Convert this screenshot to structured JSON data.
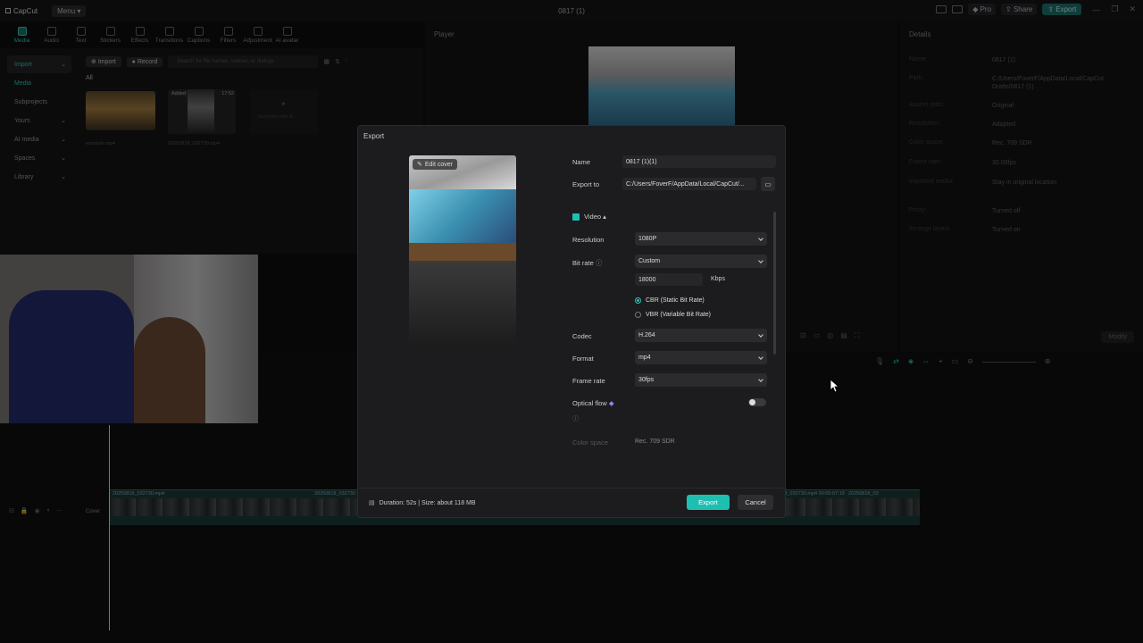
{
  "app": {
    "brand": "CapCut",
    "menu": "Menu",
    "project_title": "0817 (1)"
  },
  "titlebar": {
    "pro": "Pro",
    "share": "Share",
    "export": "Export"
  },
  "toolbar": [
    "Media",
    "Audio",
    "Text",
    "Stickers",
    "Effects",
    "Transitions",
    "Captions",
    "Filters",
    "Adjustment",
    "AI avatar"
  ],
  "sidebar": [
    "Import",
    "Media",
    "Subprojects",
    "Yours",
    "AI media",
    "Spaces",
    "Library"
  ],
  "media": {
    "import": "Import",
    "record": "Record",
    "search_placeholder": "Search for file names, scenes, or dialogs",
    "all_tab": "All",
    "added": "Added",
    "duration": "17:52",
    "clip1": "example.mp4",
    "clip2": "20250818_032730.mp4",
    "generate": "Generate with AI"
  },
  "player": {
    "title": "Player"
  },
  "details": {
    "title": "Details",
    "rows": [
      {
        "k": "Name:",
        "v": "0817 (1)"
      },
      {
        "k": "Path:",
        "v": "C:/Users/FoverF/AppData/Local/CapCut Drafts/0817 (1)"
      },
      {
        "k": "Aspect ratio:",
        "v": "Original"
      },
      {
        "k": "Resolution:",
        "v": "Adapted"
      },
      {
        "k": "Color space:",
        "v": "Rec. 709 SDR"
      },
      {
        "k": "Frame rate:",
        "v": "30.00fps"
      },
      {
        "k": "Imported media:",
        "v": "Stay in original location"
      },
      {
        "k": "Proxy:",
        "v": "Turned off"
      },
      {
        "k": "Arrange layers",
        "v": "Turned on"
      }
    ],
    "modify": "Modify"
  },
  "timeline": {
    "cover": "Cover",
    "clip_labels": [
      "20250818_032730.mp4  00:00:07:19",
      "20250818_03",
      "20250818_032730.mp4",
      "20250818_032730"
    ]
  },
  "export_dialog": {
    "title": "Export",
    "edit_cover": "Edit cover",
    "name_label": "Name",
    "name_value": "0817 (1)(1)",
    "export_to_label": "Export to",
    "export_to_value": "C:/Users/FoverF/AppData/Local/CapCut/...",
    "video_label": "Video",
    "resolution_label": "Resolution",
    "resolution_value": "1080P",
    "bitrate_label": "Bit rate",
    "bitrate_value": "Custom",
    "kbps_value": "18000",
    "kbps_unit": "Kbps",
    "cbr": "CBR (Static Bit Rate)",
    "vbr": "VBR (Variable Bit Rate)",
    "codec_label": "Codec",
    "codec_value": "H.264",
    "format_label": "Format",
    "format_value": "mp4",
    "framerate_label": "Frame rate",
    "framerate_value": "30fps",
    "optical_flow_label": "Optical flow",
    "colorspace_label": "Color space",
    "colorspace_value": "Rec. 709 SDR",
    "footer_info": "Duration: 52s | Size: about 118 MB",
    "export_button": "Export",
    "cancel_button": "Cancel"
  },
  "colors": {
    "accent": "#1ebfb1",
    "panel": "#1c1c1e",
    "background": "#0e0e0f"
  }
}
